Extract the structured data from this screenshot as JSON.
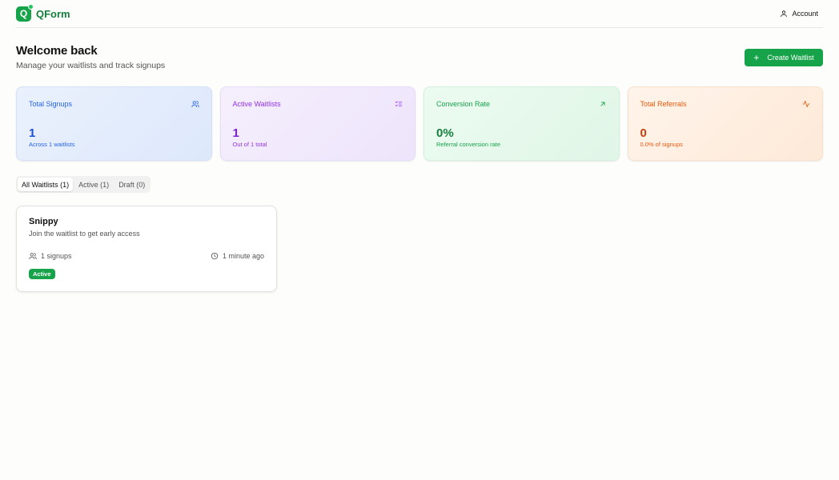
{
  "brand": {
    "logo_letter": "Q",
    "name": "QForm",
    "color": "#16a34a"
  },
  "header": {
    "account_label": "Account",
    "account_icon": "user-icon"
  },
  "welcome": {
    "title": "Welcome back",
    "subtitle": "Manage your waitlists and track signups"
  },
  "create_button": {
    "icon": "plus-icon",
    "label": "Create Waitlist"
  },
  "stats": [
    {
      "title": "Total Signups",
      "value": "1",
      "sub": "Across 1 waitlists",
      "icon": "users-icon",
      "color": "#2563eb"
    },
    {
      "title": "Active Waitlists",
      "value": "1",
      "sub": "Out of 1 total",
      "icon": "list-checks-icon",
      "color": "#9333ea"
    },
    {
      "title": "Conversion Rate",
      "value": "0%",
      "sub": "Referral conversion rate",
      "icon": "arrow-up-right-icon",
      "color": "#16a34a"
    },
    {
      "title": "Total Referrals",
      "value": "0",
      "sub": "0.0% of signups",
      "icon": "activity-icon",
      "color": "#ea580c"
    }
  ],
  "tabs": [
    {
      "label": "All Waitlists (1)",
      "active": true
    },
    {
      "label": "Active (1)",
      "active": false
    },
    {
      "label": "Draft (0)",
      "active": false
    }
  ],
  "waitlists": [
    {
      "name": "Snippy",
      "description": "Join the waitlist to get early access",
      "signups": "1 signups",
      "updated": "1 minute ago",
      "status": "Active"
    }
  ]
}
